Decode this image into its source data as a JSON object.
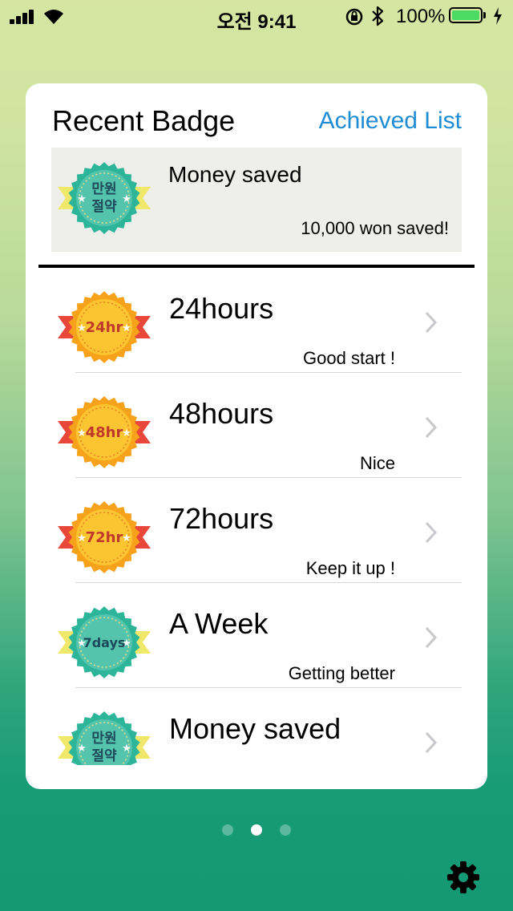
{
  "status_bar": {
    "time": "오전 9:41",
    "battery": "100%",
    "battery_level": 1.0,
    "icons": [
      "signal-icon",
      "wifi-icon",
      "orientation-lock-icon",
      "bluetooth-icon",
      "battery-icon",
      "charging-icon"
    ]
  },
  "card": {
    "title": "Recent Badge",
    "achieved_link": "Achieved List",
    "recent": {
      "title": "Money saved",
      "description": "10,000 won saved!",
      "badge_text": [
        "만원",
        "절약"
      ],
      "badge_color": "teal"
    }
  },
  "badges": [
    {
      "title": "24hours",
      "subtitle": "Good start !",
      "badge_text": [
        "24hr"
      ],
      "badge_color": "orange"
    },
    {
      "title": "48hours",
      "subtitle": "Nice",
      "badge_text": [
        "48hr"
      ],
      "badge_color": "orange"
    },
    {
      "title": "72hours",
      "subtitle": "Keep it up !",
      "badge_text": [
        "72hr"
      ],
      "badge_color": "orange"
    },
    {
      "title": "A Week",
      "subtitle": "Getting better",
      "badge_text": [
        "7days"
      ],
      "badge_color": "teal"
    },
    {
      "title": "Money saved",
      "subtitle": "",
      "badge_text": [
        "만원",
        "절약"
      ],
      "badge_color": "teal"
    }
  ],
  "page_control": {
    "count": 3,
    "current": 2
  },
  "colors": {
    "accent_link": "#1f8cd6",
    "orange_badge": "#f7a21b",
    "teal_badge": "#2db59a",
    "orange_ribbon": "#e8473a",
    "teal_ribbon": "#f0e86a"
  }
}
